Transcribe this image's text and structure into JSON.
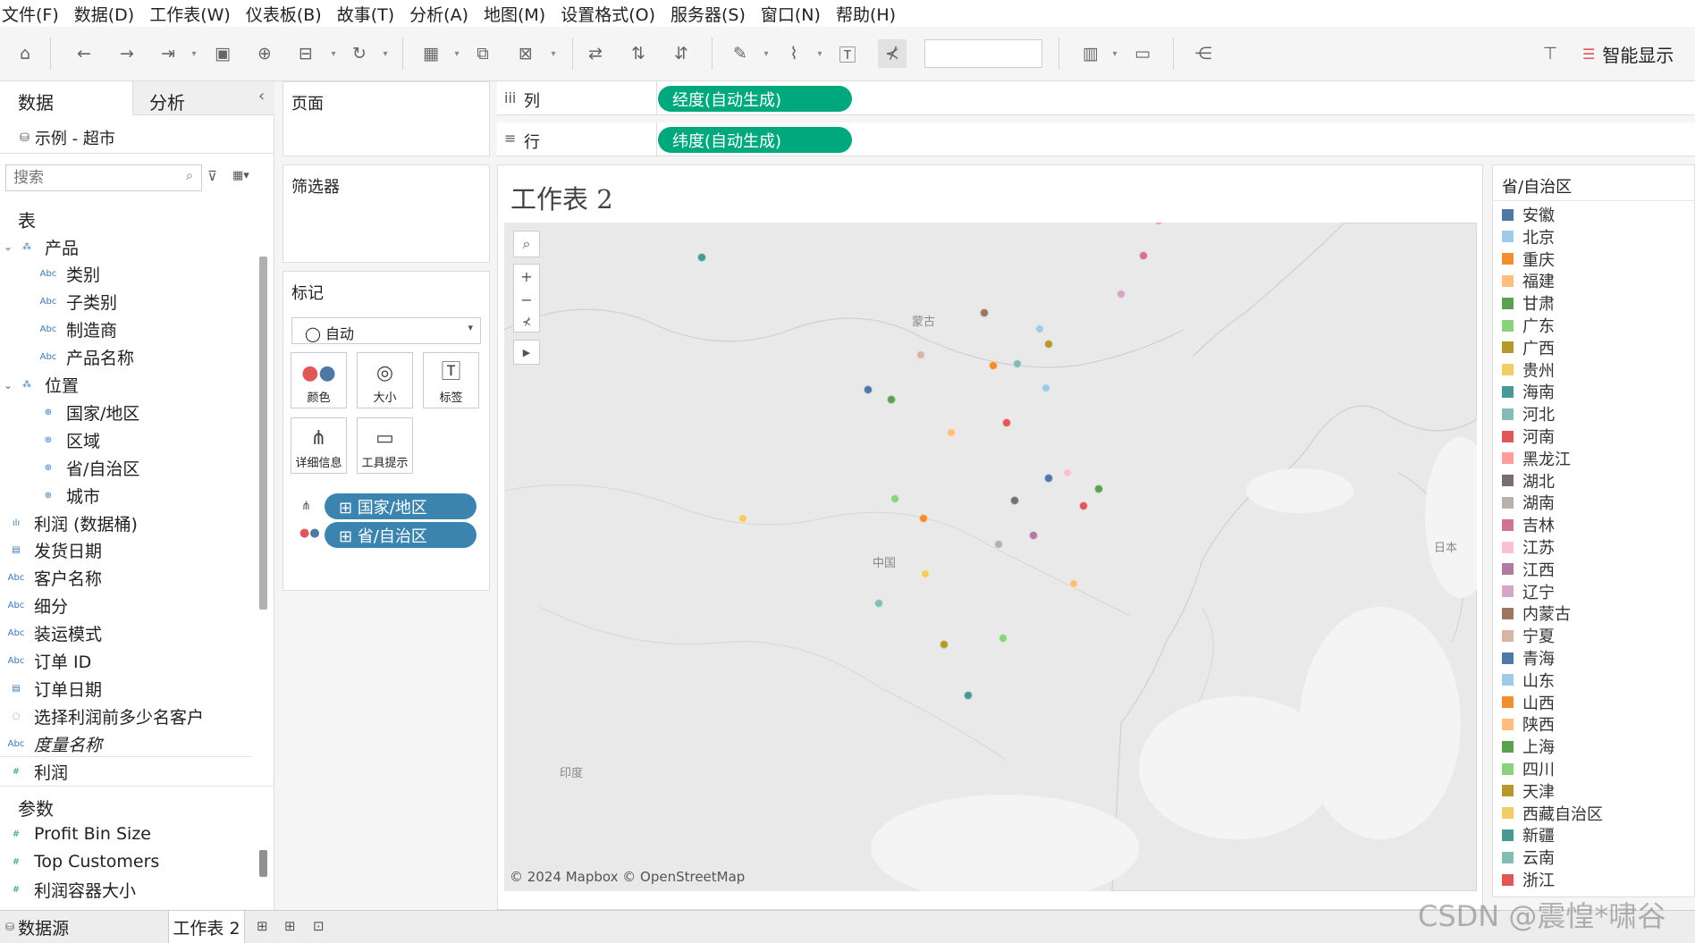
{
  "menu": [
    "文件(F)",
    "数据(D)",
    "工作表(W)",
    "仪表板(B)",
    "故事(T)",
    "分析(A)",
    "地图(M)",
    "设置格式(O)",
    "服务器(S)",
    "窗口(N)",
    "帮助(H)"
  ],
  "toolbar": {
    "smart_show": "智能显示"
  },
  "left": {
    "tab_data": "数据",
    "tab_analysis": "分析",
    "collapse": "‹",
    "datasource": "示例 - 超市",
    "search_placeholder": "搜索",
    "tables_header": "表",
    "fields": [
      {
        "label": "产品",
        "icon": "⁂",
        "indent": 0,
        "expand": "⌄"
      },
      {
        "label": "类别",
        "icon": "Abc",
        "indent": 1
      },
      {
        "label": "子类别",
        "icon": "Abc",
        "indent": 1
      },
      {
        "label": "制造商",
        "icon": "Abc",
        "indent": 1
      },
      {
        "label": "产品名称",
        "icon": "Abc",
        "indent": 1
      },
      {
        "label": "位置",
        "icon": "⁂",
        "indent": 0,
        "expand": "⌄"
      },
      {
        "label": "国家/地区",
        "icon": "⊕",
        "indent": 1
      },
      {
        "label": "区域",
        "icon": "⊕",
        "indent": 1
      },
      {
        "label": "省/自治区",
        "icon": "⊕",
        "indent": 1
      },
      {
        "label": "城市",
        "icon": "⊕",
        "indent": 1
      },
      {
        "label": "利润 (数据桶)",
        "icon": "ılı",
        "indent": 0
      },
      {
        "label": "发货日期",
        "icon": "▤",
        "indent": 0
      },
      {
        "label": "客户名称",
        "icon": "Abc",
        "indent": 0
      },
      {
        "label": "细分",
        "icon": "Abc",
        "indent": 0
      },
      {
        "label": "装运模式",
        "icon": "Abc",
        "indent": 0
      },
      {
        "label": "订单 ID",
        "icon": "Abc",
        "indent": 0
      },
      {
        "label": "订单日期",
        "icon": "▤",
        "indent": 0
      },
      {
        "label": "选择利润前多少名客户",
        "icon": "◌",
        "indent": 0
      },
      {
        "label": "度量名称",
        "icon": "Abc",
        "indent": 0,
        "italic": true
      },
      {
        "label": "利润",
        "icon": "#",
        "indent": 0,
        "green": true
      }
    ],
    "params_header": "参数",
    "params": [
      "Profit Bin Size",
      "Top Customers",
      "利润容器大小"
    ]
  },
  "cards": {
    "pages": "页面",
    "filters": "筛选器",
    "marks": "标记",
    "mark_type": "◯ 自动",
    "buttons": [
      {
        "label": "颜色",
        "icon": "color-icon"
      },
      {
        "label": "大小",
        "icon": "size-icon"
      },
      {
        "label": "标签",
        "icon": "label-icon"
      },
      {
        "label": "详细信息",
        "icon": "detail-icon"
      },
      {
        "label": "工具提示",
        "icon": "tooltip-icon"
      }
    ],
    "mark_pills": [
      "⊞ 国家/地区",
      "⊞ 省/自治区"
    ]
  },
  "shelves": {
    "columns_label": "列",
    "rows_label": "行",
    "columns_pill": "经度(自动生成)",
    "rows_pill": "纬度(自动生成)"
  },
  "view": {
    "title": "工作表 2",
    "attribution": "© 2024 Mapbox © OpenStreetMap",
    "map_labels": [
      "蒙古",
      "中国",
      "印度",
      "日本"
    ]
  },
  "legend": {
    "title": "省/自治区",
    "items": [
      {
        "name": "安徽",
        "color": "#4e79a7"
      },
      {
        "name": "北京",
        "color": "#a0cbe8"
      },
      {
        "name": "重庆",
        "color": "#f28e2b"
      },
      {
        "name": "福建",
        "color": "#ffbe7d"
      },
      {
        "name": "甘肃",
        "color": "#59a14f"
      },
      {
        "name": "广东",
        "color": "#8cd17d"
      },
      {
        "name": "广西",
        "color": "#b6992d"
      },
      {
        "name": "贵州",
        "color": "#f1ce63"
      },
      {
        "name": "海南",
        "color": "#499894"
      },
      {
        "name": "河北",
        "color": "#86bcb6"
      },
      {
        "name": "河南",
        "color": "#e15759"
      },
      {
        "name": "黑龙江",
        "color": "#ff9d9a"
      },
      {
        "name": "湖北",
        "color": "#79706e"
      },
      {
        "name": "湖南",
        "color": "#bab0ac"
      },
      {
        "name": "吉林",
        "color": "#d37295"
      },
      {
        "name": "江苏",
        "color": "#fabfd2"
      },
      {
        "name": "江西",
        "color": "#b07aa1"
      },
      {
        "name": "辽宁",
        "color": "#d4a6c8"
      },
      {
        "name": "内蒙古",
        "color": "#9d7660"
      },
      {
        "name": "宁夏",
        "color": "#d7b5a6"
      },
      {
        "name": "青海",
        "color": "#4e79a7"
      },
      {
        "name": "山东",
        "color": "#a0cbe8"
      },
      {
        "name": "山西",
        "color": "#f28e2b"
      },
      {
        "name": "陕西",
        "color": "#ffbe7d"
      },
      {
        "name": "上海",
        "color": "#59a14f"
      },
      {
        "name": "四川",
        "color": "#8cd17d"
      },
      {
        "name": "天津",
        "color": "#b6992d"
      },
      {
        "name": "西藏自治区",
        "color": "#f1ce63"
      },
      {
        "name": "新疆",
        "color": "#499894"
      },
      {
        "name": "云南",
        "color": "#86bcb6"
      },
      {
        "name": "浙江",
        "color": "#e15759"
      }
    ]
  },
  "bottom": {
    "datasource_tab": "数据源",
    "sheet_tab": "工作表 2"
  },
  "watermark": "CSDN @震惶*啸谷"
}
